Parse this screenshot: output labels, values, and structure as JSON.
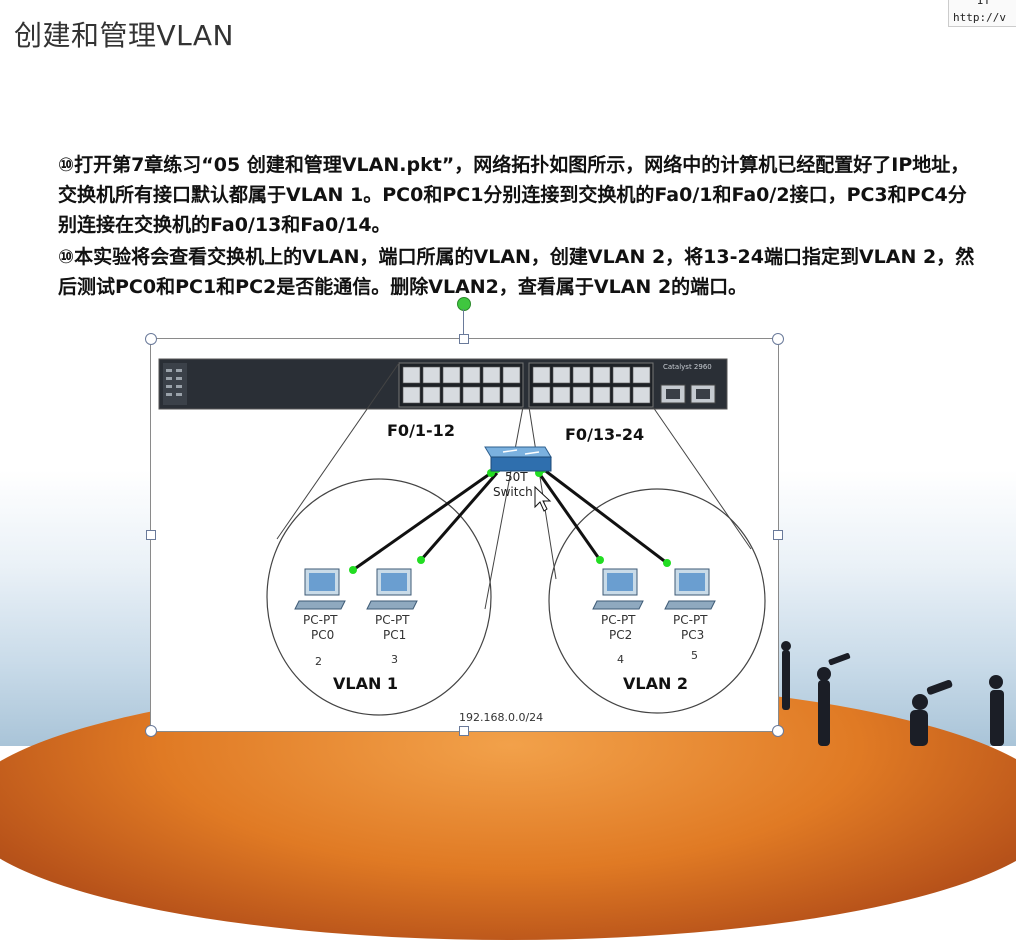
{
  "slide": {
    "title": "创建和管理VLAN",
    "paragraph1": "⑩打开第7章练习“05 创建和管理VLAN.pkt”，网络拓扑如图所示，网络中的计算机已经配置好了IP地址，交换机所有接口默认都属于VLAN 1。PC0和PC1分别连接到交换机的Fa0/1和Fa0/2接口，PC3和PC4分别连接在交换机的Fa0/13和Fa0/14。",
    "paragraph2": "⑩本实验将会查看交换机上的VLAN，端口所属的VLAN，创建VLAN 2，将13-24端口指定到VLAN 2，然后测试PC0和PC1和PC2是否能通信。删除VLAN2，查看属于VLAN 2的端口。"
  },
  "corner": {
    "line1": "IT",
    "line2": "http://v"
  },
  "diagram": {
    "switch_brand": "Catalyst 2960",
    "port_group_left": "F0/1-12",
    "port_group_right": "F0/13-24",
    "switch_label_line1": "50T",
    "switch_label_line2": "Switch",
    "network": "192.168.0.0/24",
    "vlans": [
      "VLAN 1",
      "VLAN 2"
    ],
    "pcs": [
      {
        "type": "PC-PT",
        "name": "PC0",
        "num": "2"
      },
      {
        "type": "PC-PT",
        "name": "PC1",
        "num": "3"
      },
      {
        "type": "PC-PT",
        "name": "PC2",
        "num": "4"
      },
      {
        "type": "PC-PT",
        "name": "PC3",
        "num": "5"
      }
    ],
    "colors": {
      "link": "#111111",
      "link_dot": "#22dd22",
      "switch_body": "#2a2f36"
    }
  }
}
